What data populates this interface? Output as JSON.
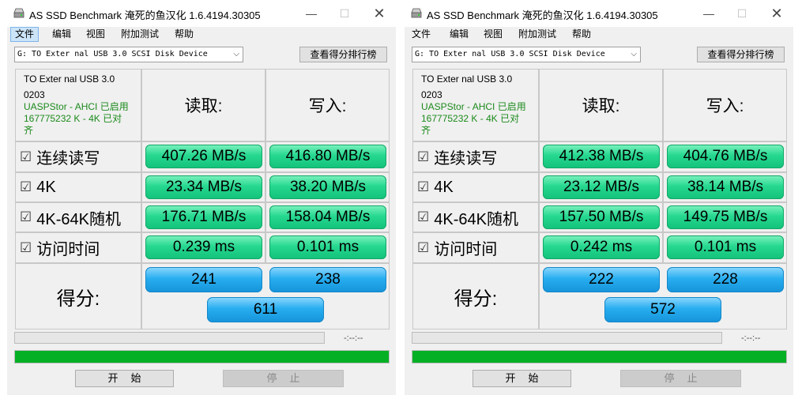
{
  "windows": [
    {
      "title": "AS SSD Benchmark 淹死的鱼汉化 1.6.4194.30305",
      "menu": [
        "文件",
        "编辑",
        "视图",
        "附加测试",
        "帮助"
      ],
      "active_menu": 0,
      "drive": "G: TO Exter nal USB 3.0 SCSI Disk Device",
      "rank_button": "查看得分排行榜",
      "device_info": {
        "name": "TO Exter nal USB 3.0",
        "firmware": "0203",
        "driver": "UASPStor - AHCI 已启用",
        "alignment": "167775232 K - 4K 已对",
        "alignment_cont": "齐"
      },
      "read_header": "读取:",
      "write_header": "写入:",
      "rows": [
        {
          "label": "连续读写",
          "checked": "☑",
          "read": "407.26 MB/s",
          "write": "416.80 MB/s"
        },
        {
          "label": "4K",
          "checked": "☑",
          "read": "23.34 MB/s",
          "write": "38.20 MB/s"
        },
        {
          "label": "4K-64K随机",
          "checked": "☑",
          "read": "176.71 MB/s",
          "write": "158.04 MB/s"
        },
        {
          "label": "访问时间",
          "checked": "☑",
          "read": "0.239 ms",
          "write": "0.101 ms"
        }
      ],
      "score_label": "得分:",
      "score_read": "241",
      "score_write": "238",
      "score_total": "611",
      "time_display": "-:--:--",
      "progress": 1.0,
      "start_button": "开始",
      "stop_button": "停止"
    },
    {
      "title": "AS SSD Benchmark 淹死的鱼汉化 1.6.4194.30305",
      "menu": [
        "文件",
        "编辑",
        "视图",
        "附加测试",
        "帮助"
      ],
      "active_menu": -1,
      "drive": "G: TO Exter nal USB 3.0 SCSI Disk Device",
      "rank_button": "查看得分排行榜",
      "device_info": {
        "name": "TO Exter nal USB 3.0",
        "firmware": "0203",
        "driver": "UASPStor - AHCI 已启用",
        "alignment": "167775232 K - 4K 已对",
        "alignment_cont": "齐"
      },
      "read_header": "读取:",
      "write_header": "写入:",
      "rows": [
        {
          "label": "连续读写",
          "checked": "☑",
          "read": "412.38 MB/s",
          "write": "404.76 MB/s"
        },
        {
          "label": "4K",
          "checked": "☑",
          "read": "23.12 MB/s",
          "write": "38.14 MB/s"
        },
        {
          "label": "4K-64K随机",
          "checked": "☑",
          "read": "157.50 MB/s",
          "write": "149.75 MB/s"
        },
        {
          "label": "访问时间",
          "checked": "☑",
          "read": "0.242 ms",
          "write": "0.101 ms"
        }
      ],
      "score_label": "得分:",
      "score_read": "222",
      "score_write": "228",
      "score_total": "572",
      "time_display": "-:--:--",
      "progress": 1.0,
      "start_button": "开始",
      "stop_button": "停止"
    }
  ],
  "window_controls": {
    "minimize": "—",
    "maximize": "☐",
    "close": "✕"
  },
  "drive_arrow": "⌵",
  "colors": {
    "green": "#26d890",
    "blue": "#28aef0",
    "progress": "#06b025",
    "info_green": "#1c8a1c"
  }
}
